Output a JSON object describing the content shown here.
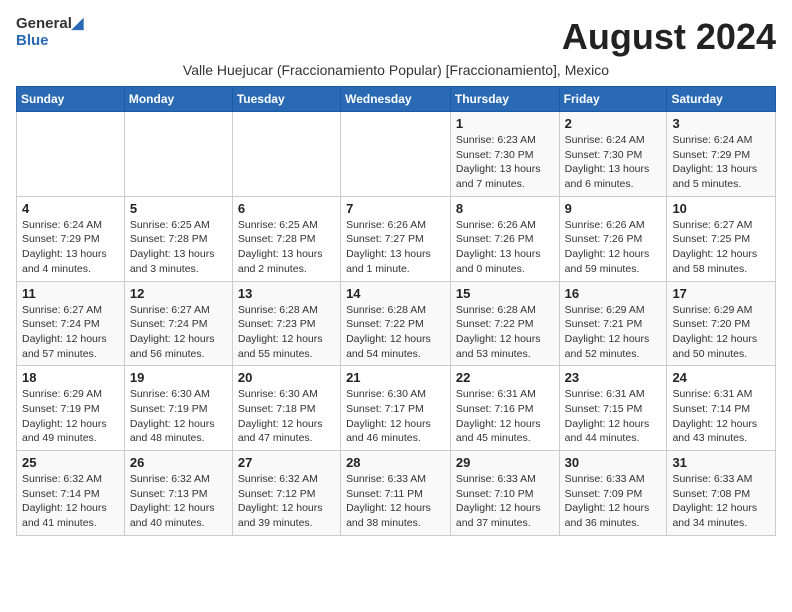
{
  "header": {
    "logo_general": "General",
    "logo_blue": "Blue",
    "month_year": "August 2024"
  },
  "subtitle": "Valle Huejucar (Fraccionamiento Popular) [Fraccionamiento], Mexico",
  "days_of_week": [
    "Sunday",
    "Monday",
    "Tuesday",
    "Wednesday",
    "Thursday",
    "Friday",
    "Saturday"
  ],
  "weeks": [
    [
      {
        "day": "",
        "info": ""
      },
      {
        "day": "",
        "info": ""
      },
      {
        "day": "",
        "info": ""
      },
      {
        "day": "",
        "info": ""
      },
      {
        "day": "1",
        "info": "Sunrise: 6:23 AM\nSunset: 7:30 PM\nDaylight: 13 hours and 7 minutes."
      },
      {
        "day": "2",
        "info": "Sunrise: 6:24 AM\nSunset: 7:30 PM\nDaylight: 13 hours and 6 minutes."
      },
      {
        "day": "3",
        "info": "Sunrise: 6:24 AM\nSunset: 7:29 PM\nDaylight: 13 hours and 5 minutes."
      }
    ],
    [
      {
        "day": "4",
        "info": "Sunrise: 6:24 AM\nSunset: 7:29 PM\nDaylight: 13 hours and 4 minutes."
      },
      {
        "day": "5",
        "info": "Sunrise: 6:25 AM\nSunset: 7:28 PM\nDaylight: 13 hours and 3 minutes."
      },
      {
        "day": "6",
        "info": "Sunrise: 6:25 AM\nSunset: 7:28 PM\nDaylight: 13 hours and 2 minutes."
      },
      {
        "day": "7",
        "info": "Sunrise: 6:26 AM\nSunset: 7:27 PM\nDaylight: 13 hours and 1 minute."
      },
      {
        "day": "8",
        "info": "Sunrise: 6:26 AM\nSunset: 7:26 PM\nDaylight: 13 hours and 0 minutes."
      },
      {
        "day": "9",
        "info": "Sunrise: 6:26 AM\nSunset: 7:26 PM\nDaylight: 12 hours and 59 minutes."
      },
      {
        "day": "10",
        "info": "Sunrise: 6:27 AM\nSunset: 7:25 PM\nDaylight: 12 hours and 58 minutes."
      }
    ],
    [
      {
        "day": "11",
        "info": "Sunrise: 6:27 AM\nSunset: 7:24 PM\nDaylight: 12 hours and 57 minutes."
      },
      {
        "day": "12",
        "info": "Sunrise: 6:27 AM\nSunset: 7:24 PM\nDaylight: 12 hours and 56 minutes."
      },
      {
        "day": "13",
        "info": "Sunrise: 6:28 AM\nSunset: 7:23 PM\nDaylight: 12 hours and 55 minutes."
      },
      {
        "day": "14",
        "info": "Sunrise: 6:28 AM\nSunset: 7:22 PM\nDaylight: 12 hours and 54 minutes."
      },
      {
        "day": "15",
        "info": "Sunrise: 6:28 AM\nSunset: 7:22 PM\nDaylight: 12 hours and 53 minutes."
      },
      {
        "day": "16",
        "info": "Sunrise: 6:29 AM\nSunset: 7:21 PM\nDaylight: 12 hours and 52 minutes."
      },
      {
        "day": "17",
        "info": "Sunrise: 6:29 AM\nSunset: 7:20 PM\nDaylight: 12 hours and 50 minutes."
      }
    ],
    [
      {
        "day": "18",
        "info": "Sunrise: 6:29 AM\nSunset: 7:19 PM\nDaylight: 12 hours and 49 minutes."
      },
      {
        "day": "19",
        "info": "Sunrise: 6:30 AM\nSunset: 7:19 PM\nDaylight: 12 hours and 48 minutes."
      },
      {
        "day": "20",
        "info": "Sunrise: 6:30 AM\nSunset: 7:18 PM\nDaylight: 12 hours and 47 minutes."
      },
      {
        "day": "21",
        "info": "Sunrise: 6:30 AM\nSunset: 7:17 PM\nDaylight: 12 hours and 46 minutes."
      },
      {
        "day": "22",
        "info": "Sunrise: 6:31 AM\nSunset: 7:16 PM\nDaylight: 12 hours and 45 minutes."
      },
      {
        "day": "23",
        "info": "Sunrise: 6:31 AM\nSunset: 7:15 PM\nDaylight: 12 hours and 44 minutes."
      },
      {
        "day": "24",
        "info": "Sunrise: 6:31 AM\nSunset: 7:14 PM\nDaylight: 12 hours and 43 minutes."
      }
    ],
    [
      {
        "day": "25",
        "info": "Sunrise: 6:32 AM\nSunset: 7:14 PM\nDaylight: 12 hours and 41 minutes."
      },
      {
        "day": "26",
        "info": "Sunrise: 6:32 AM\nSunset: 7:13 PM\nDaylight: 12 hours and 40 minutes."
      },
      {
        "day": "27",
        "info": "Sunrise: 6:32 AM\nSunset: 7:12 PM\nDaylight: 12 hours and 39 minutes."
      },
      {
        "day": "28",
        "info": "Sunrise: 6:33 AM\nSunset: 7:11 PM\nDaylight: 12 hours and 38 minutes."
      },
      {
        "day": "29",
        "info": "Sunrise: 6:33 AM\nSunset: 7:10 PM\nDaylight: 12 hours and 37 minutes."
      },
      {
        "day": "30",
        "info": "Sunrise: 6:33 AM\nSunset: 7:09 PM\nDaylight: 12 hours and 36 minutes."
      },
      {
        "day": "31",
        "info": "Sunrise: 6:33 AM\nSunset: 7:08 PM\nDaylight: 12 hours and 34 minutes."
      }
    ]
  ]
}
